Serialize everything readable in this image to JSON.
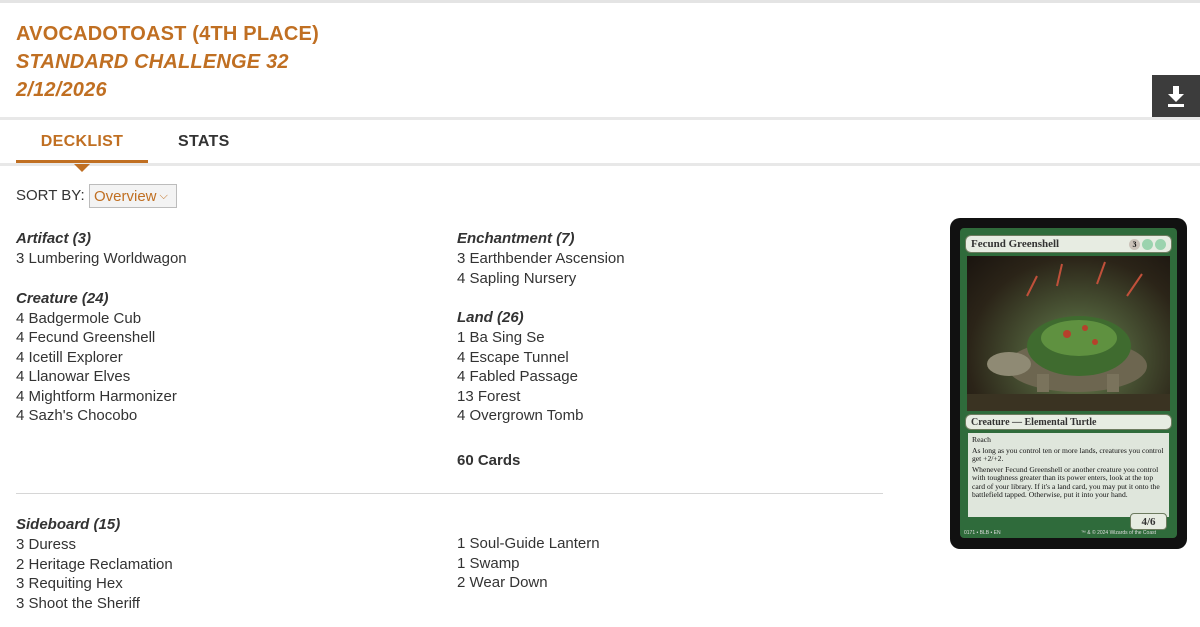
{
  "header": {
    "player": "AVOCADOTOAST (4TH PLACE)",
    "event": "STANDARD CHALLENGE 32",
    "date": "2/12/2026",
    "download_icon": "download-icon"
  },
  "tabs": [
    {
      "label": "DECKLIST",
      "active": true
    },
    {
      "label": "STATS",
      "active": false
    }
  ],
  "sort": {
    "label": "SORT BY:",
    "value": "Overview"
  },
  "deck": {
    "artifact": {
      "title": "Artifact (3)",
      "cards": [
        "3 Lumbering Worldwagon"
      ]
    },
    "creature": {
      "title": "Creature (24)",
      "cards": [
        "4 Badgermole Cub",
        "4 Fecund Greenshell",
        "4 Icetill Explorer",
        "4 Llanowar Elves",
        "4 Mightform Harmonizer",
        "4 Sazh's Chocobo"
      ]
    },
    "enchantment": {
      "title": "Enchantment (7)",
      "cards": [
        "3 Earthbender Ascension",
        "4 Sapling Nursery"
      ]
    },
    "land": {
      "title": "Land (26)",
      "cards": [
        "1 Ba Sing Se",
        "4 Escape Tunnel",
        "4 Fabled Passage",
        "13 Forest",
        "4 Overgrown Tomb"
      ]
    },
    "total": "60 Cards"
  },
  "sideboard": {
    "title": "Sideboard (15)",
    "left": [
      "3 Duress",
      "2 Heritage Reclamation",
      "3 Requiting Hex",
      "3 Shoot the Sheriff"
    ],
    "right": [
      "1 Soul-Guide Lantern",
      "1 Swamp",
      "2 Wear Down"
    ]
  },
  "card_preview": {
    "name": "Fecund Greenshell",
    "mana_generic": "3",
    "type_line": "Creature — Elemental Turtle",
    "text": [
      "Reach",
      "As long as you control ten or more lands, creatures you control get +2/+2.",
      "Whenever Fecund Greenshell or another creature you control with toughness greater than its power enters, look at the top card of your library. If it's a land card, you may put it onto the battlefield tapped. Otherwise, put it into your hand."
    ],
    "pt": "4/6",
    "footer_left": "0171 • BLB • EN",
    "footer_right": "™ & © 2024 Wizards of the Coast"
  },
  "colors": {
    "accent": "#c06f22",
    "download_bg": "#3c3c3c",
    "card_green": "#2f6b3b"
  }
}
